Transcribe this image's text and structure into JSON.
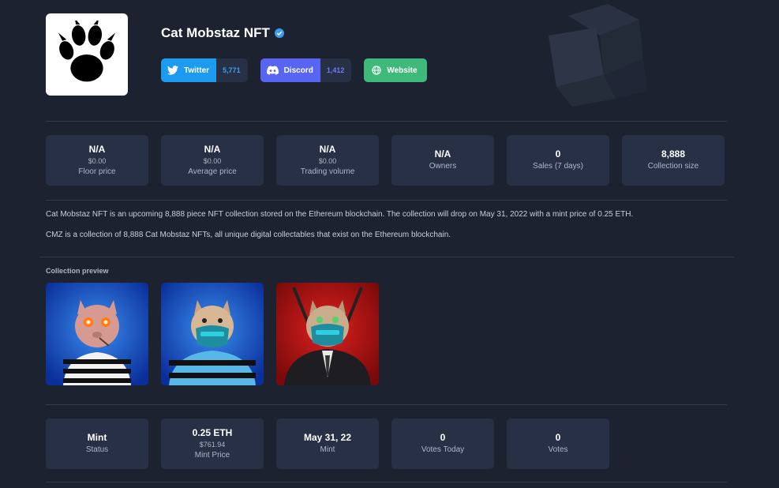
{
  "header": {
    "title": "Cat Mobstaz NFT",
    "logo_icon": "paw-print-icon",
    "verified_icon": "verified-badge-icon"
  },
  "social": {
    "twitter": {
      "label": "Twitter",
      "count": "5,771",
      "icon": "twitter-bird-icon"
    },
    "discord": {
      "label": "Discord",
      "count": "1,412",
      "icon": "discord-icon"
    },
    "website": {
      "label": "Website",
      "icon": "globe-icon"
    }
  },
  "stats": [
    {
      "value": "N/A",
      "sub": "$0.00",
      "label": "Floor price"
    },
    {
      "value": "N/A",
      "sub": "$0.00",
      "label": "Average price"
    },
    {
      "value": "N/A",
      "sub": "$0.00",
      "label": "Trading volume"
    },
    {
      "value": "N/A",
      "label": "Owners"
    },
    {
      "value": "0",
      "label": "Sales (7 days)"
    },
    {
      "value": "8,888",
      "label": "Collection size"
    }
  ],
  "description": {
    "p1": "Cat Mobstaz NFT is an upcoming 8,888 piece NFT collection stored on the Ethereum blockchain. The collection will drop on May 31, 2022 with a mint price of 0.25 ETH.",
    "p2": "CMZ is a collection of 8,888 Cat Mobstaz NFTs, all unique digital collectables that exist on the Ethereum blockchain."
  },
  "preview": {
    "label": "Collection preview",
    "items": [
      "cat-nft-striped-shirt",
      "cat-nft-blue-stripes-mask",
      "cat-nft-suit-katanas"
    ]
  },
  "mint_stats": [
    {
      "value": "Mint",
      "label": "Status"
    },
    {
      "value": "0.25 ETH",
      "sub": "$761.94",
      "label": "Mint Price"
    },
    {
      "value": "May 31, 22",
      "label": "Mint"
    },
    {
      "value": "0",
      "label": "Votes Today"
    },
    {
      "value": "0",
      "label": "Votes"
    }
  ],
  "colors": {
    "background": "#1c2230",
    "card": "#273044",
    "twitter": "#1d9bf0",
    "discord": "#5865f2",
    "website": "#3fb97a"
  }
}
